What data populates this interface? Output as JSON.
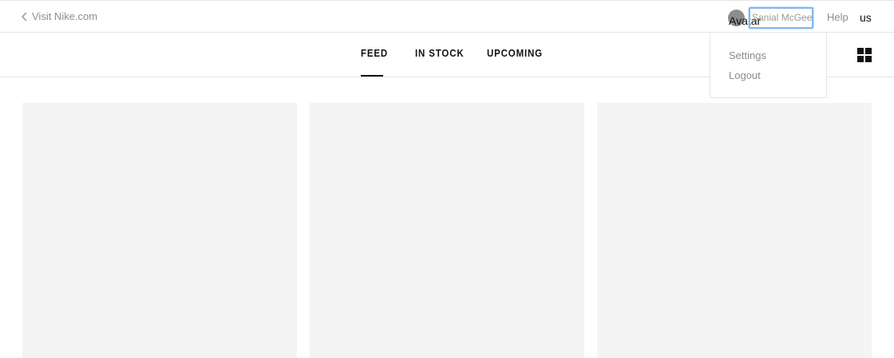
{
  "topbar": {
    "visit_label": "Visit Nike.com",
    "avatar_alt": "Avatar",
    "user_name": "Sanial McGee",
    "help_label": "Help",
    "locale": "us"
  },
  "user_menu": {
    "items": [
      {
        "label": "Settings"
      },
      {
        "label": "Logout"
      }
    ]
  },
  "nav": {
    "tabs": [
      {
        "label": "FEED",
        "active": true
      },
      {
        "label": "IN STOCK",
        "active": false
      },
      {
        "label": "UPCOMING",
        "active": false
      }
    ],
    "view_toggle_icon": "grid-icon"
  },
  "feed": {
    "cards": [
      {
        "state": "loading-placeholder"
      },
      {
        "state": "loading-placeholder"
      },
      {
        "state": "loading-placeholder"
      }
    ]
  },
  "colors": {
    "text_primary": "#111111",
    "text_muted": "#8d8d8d",
    "divider": "#e5e5e5",
    "placeholder": "#f4f4f4",
    "focus_ring": "#7fb8f4"
  }
}
